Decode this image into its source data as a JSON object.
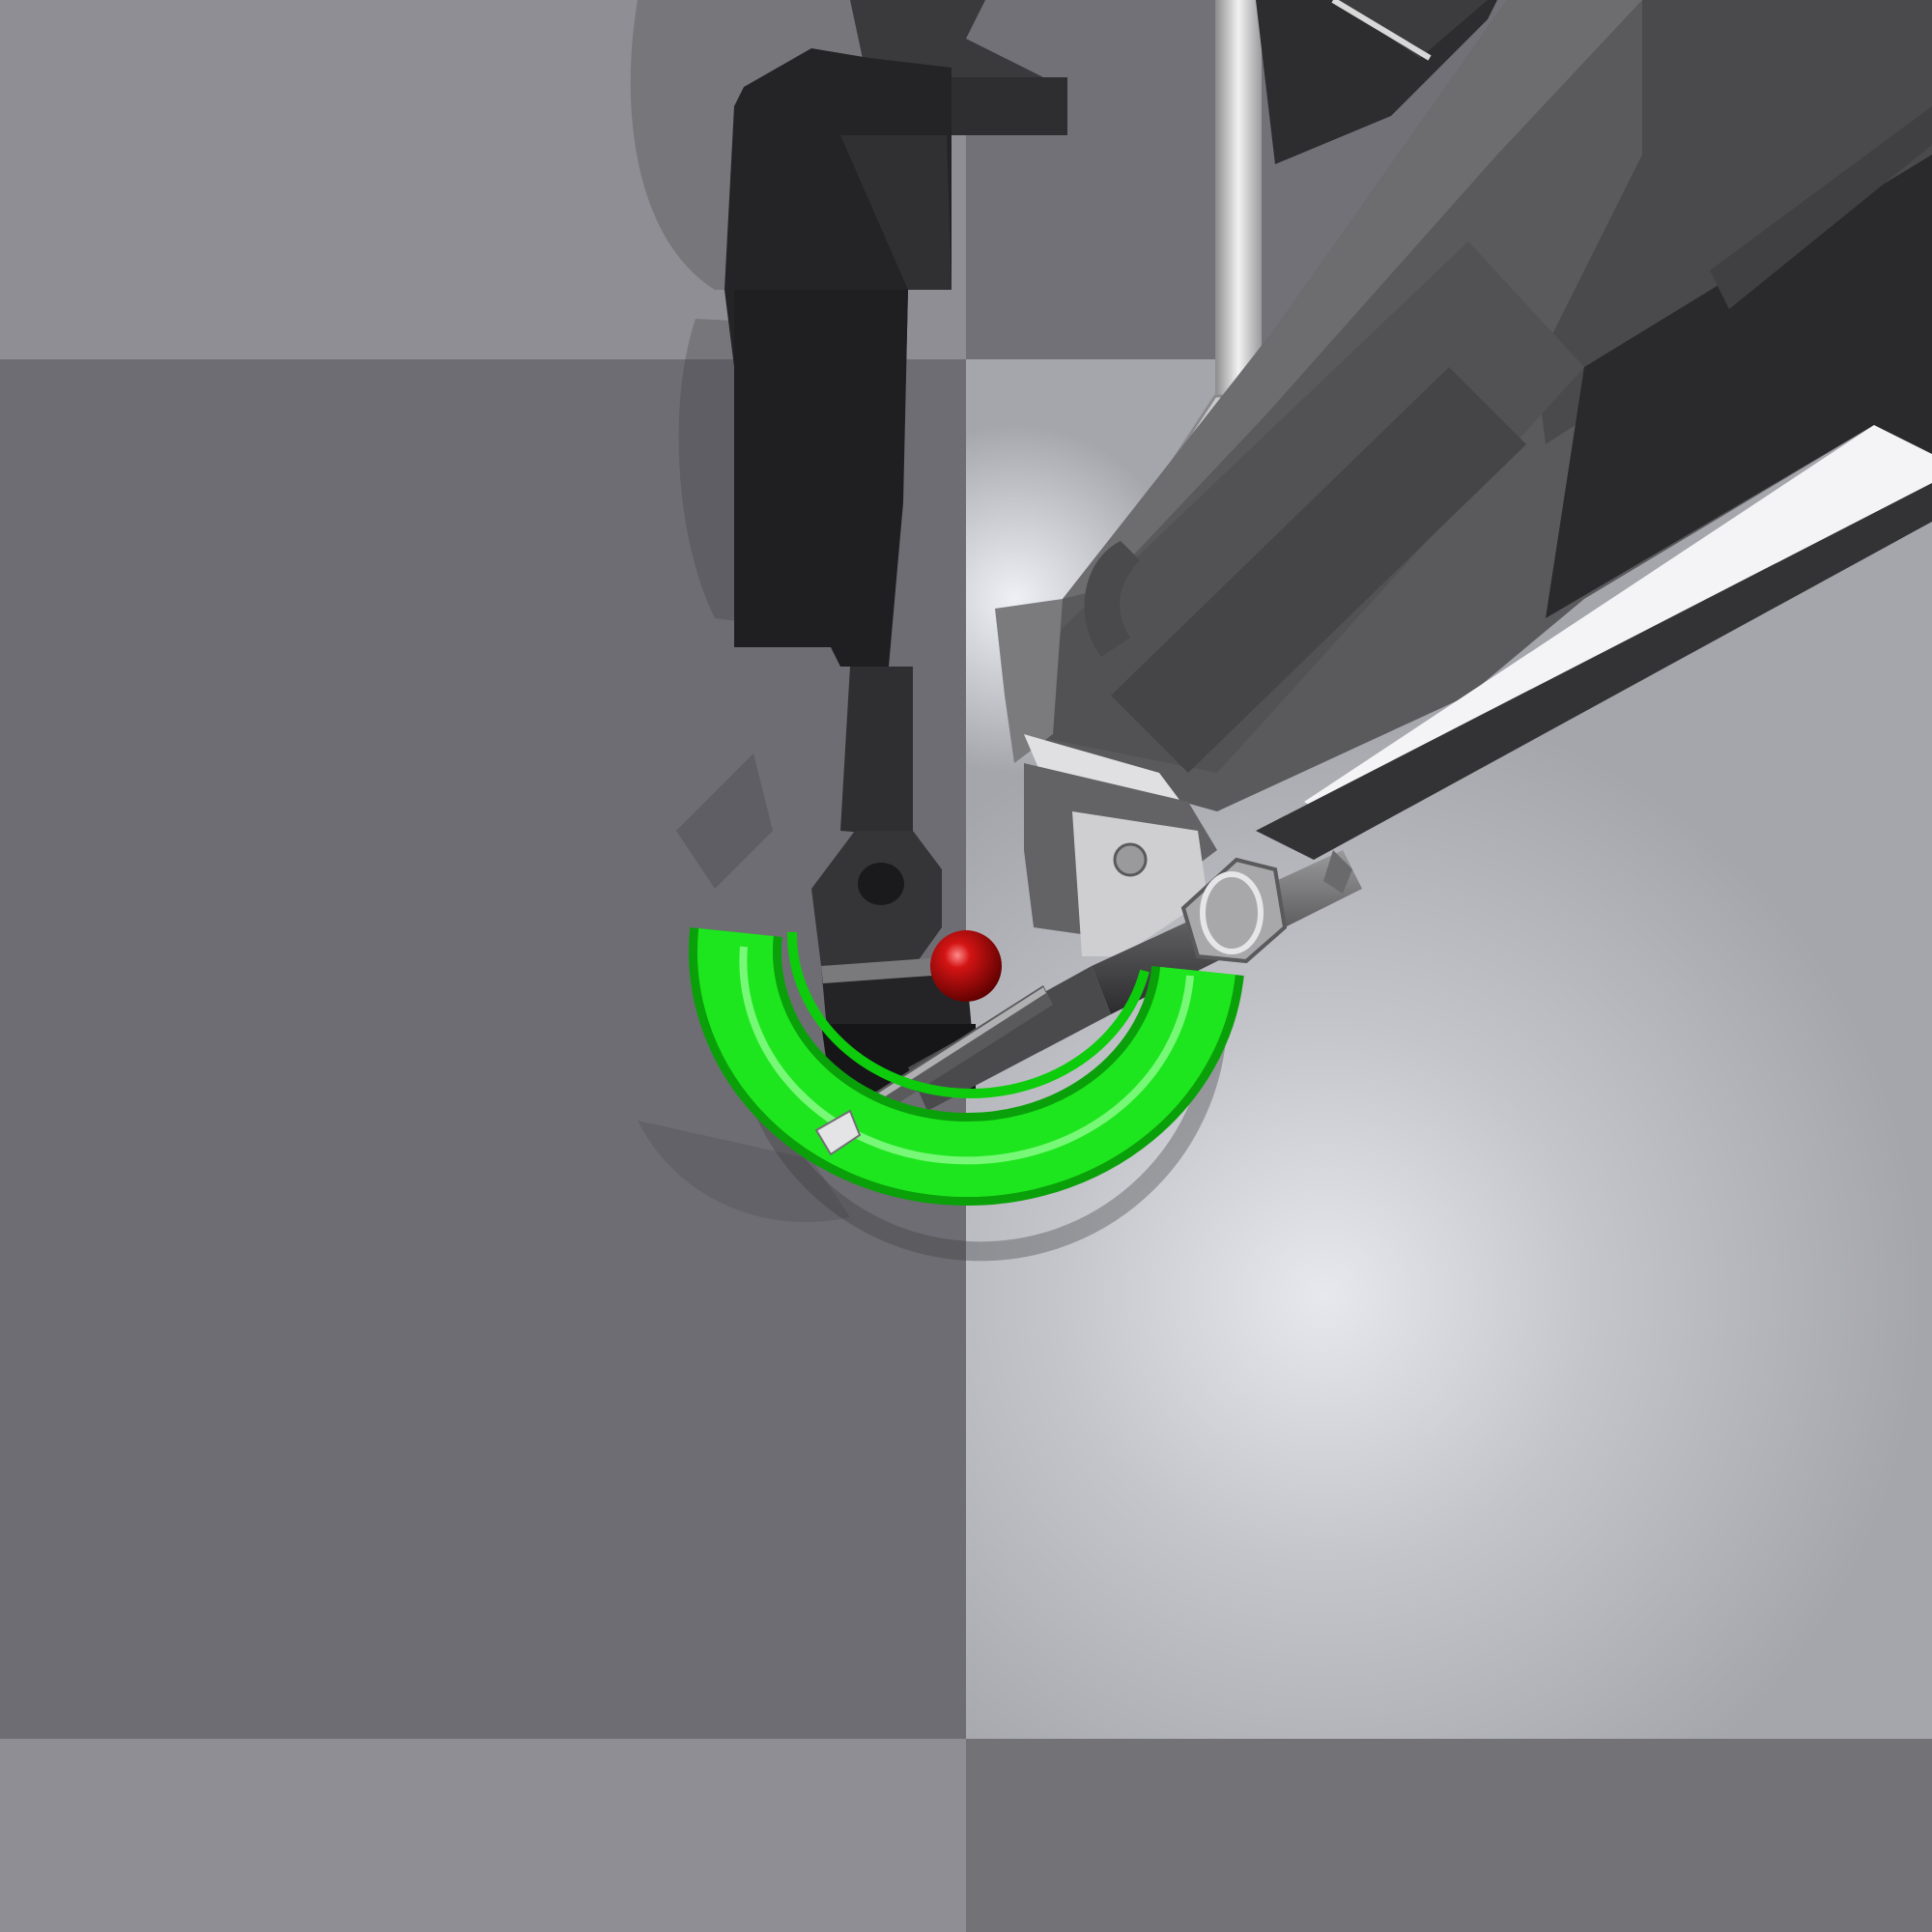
{
  "scene": {
    "kind": "3d-render",
    "description_tags": [
      "checkerboard-floor",
      "surgical-robot-arms",
      "green-half-ring-target",
      "red-sphere-marker",
      "needle-driver-tool"
    ],
    "colors": {
      "floor_light": "#8e8e94",
      "floor_dark": "#6e6d73",
      "spotlight": "#e7e8ee",
      "arm_dark": "#2e2e30",
      "arm_mid": "#4c4c4f",
      "arm_light": "#7d7d80",
      "metal_highlight": "#d6d6d8",
      "ring_green": "#1ee61e",
      "ring_green_dark": "#0aa00a",
      "ring_green_highlight": "#9cff9c",
      "sphere_red": "#c40c0c",
      "sphere_red_dark": "#5a0000"
    }
  }
}
